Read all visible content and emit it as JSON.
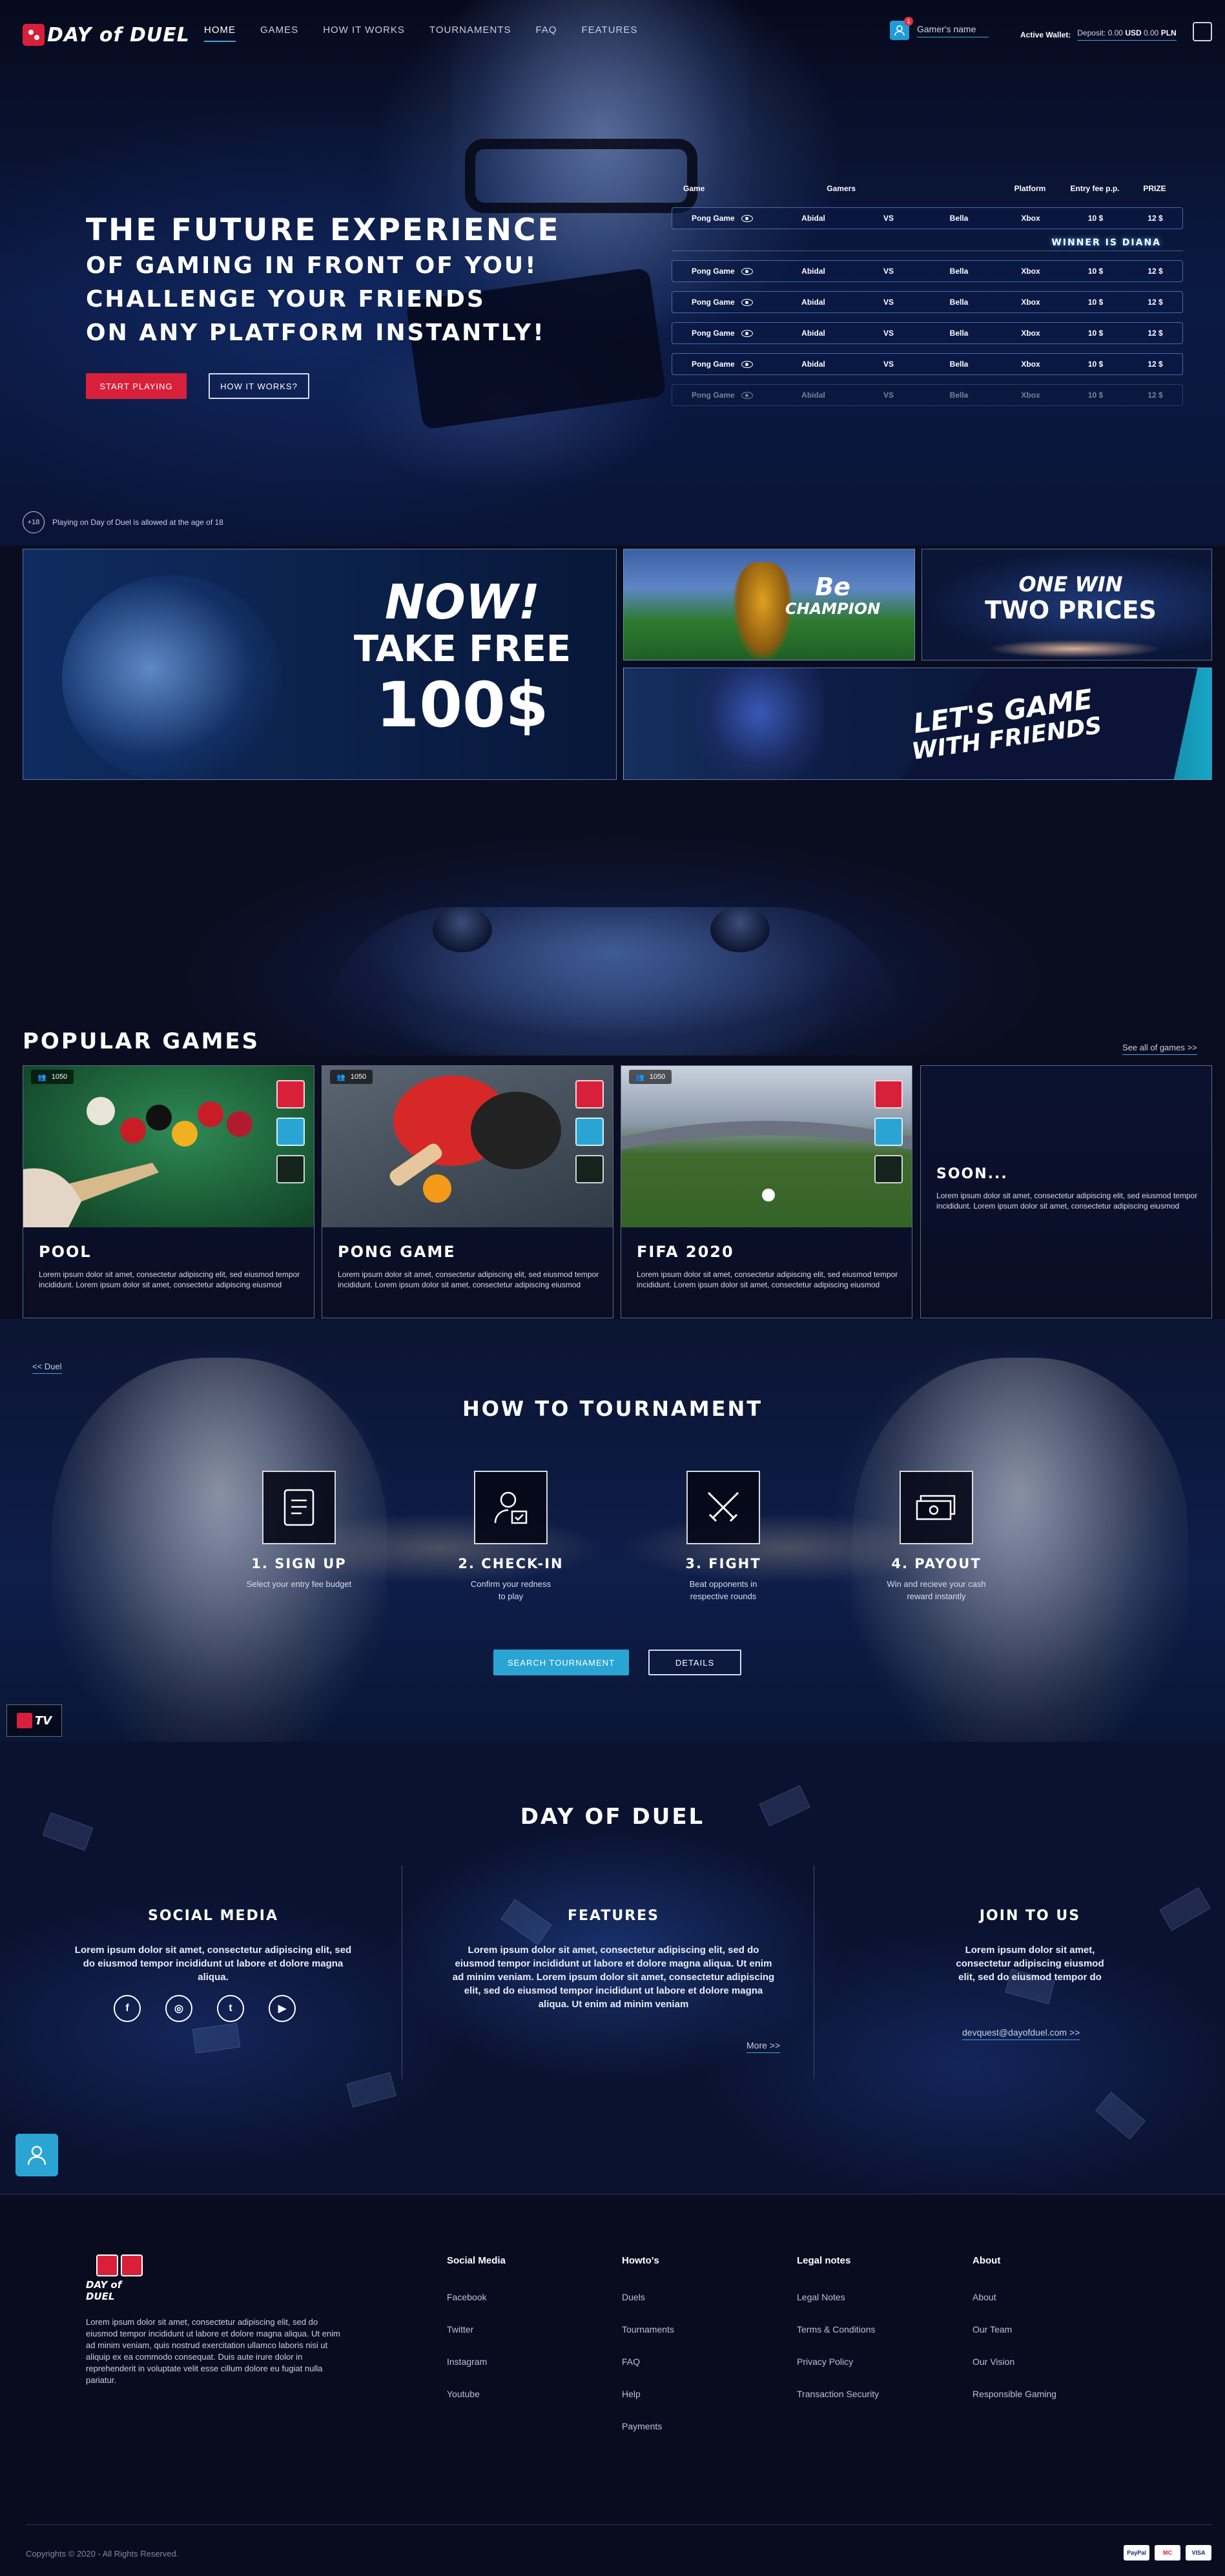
{
  "brand": {
    "logo_text": "DAY of DUEL",
    "accent_red": "#d8203a",
    "accent_blue": "#2aa5d3"
  },
  "nav": {
    "items": [
      "HOME",
      "GAMES",
      "HOW IT WORKS",
      "TOURNAMENTS",
      "FAQ",
      "FEATURES"
    ],
    "active": "HOME"
  },
  "user": {
    "name": "Gamer's name",
    "notifications": "1"
  },
  "wallet": {
    "label": "Active Wallet:",
    "value_prefix": "Deposit: 0.00",
    "usd": "USD",
    "pln_value": "0.00",
    "pln": "PLN"
  },
  "hero": {
    "line1": "THE FUTURE EXPERIENCE",
    "line2": "OF GAMING IN FRONT OF YOU!",
    "line3": "CHALLENGE YOUR FRIENDS",
    "line4": "ON ANY PLATFORM INSTANTLY!",
    "btn_start": "START PLAYING",
    "btn_how": "HOW IT WORKS?"
  },
  "game_table": {
    "headers": [
      "Game",
      "Gamers",
      "",
      "",
      "Platform",
      "Entry fee p.p.",
      "PRIZE"
    ],
    "winner_text": "WINNER IS DIANA",
    "rows": [
      {
        "game": "Pong Game",
        "p1": "Abidal",
        "vs": "VS",
        "p2": "Bella",
        "platform": "Xbox",
        "fee": "10 $",
        "prize": "12 $"
      },
      {
        "game": "Pong Game",
        "p1": "Abidal",
        "vs": "VS",
        "p2": "Bella",
        "platform": "Xbox",
        "fee": "10 $",
        "prize": "12 $"
      },
      {
        "game": "Pong Game",
        "p1": "Abidal",
        "vs": "VS",
        "p2": "Bella",
        "platform": "Xbox",
        "fee": "10 $",
        "prize": "12 $"
      },
      {
        "game": "Pong Game",
        "p1": "Abidal",
        "vs": "VS",
        "p2": "Bella",
        "platform": "Xbox",
        "fee": "10 $",
        "prize": "12 $"
      },
      {
        "game": "Pong Game",
        "p1": "Abidal",
        "vs": "VS",
        "p2": "Bella",
        "platform": "Xbox",
        "fee": "10 $",
        "prize": "12 $"
      },
      {
        "game": "Pong Game",
        "p1": "Abidal",
        "vs": "VS",
        "p2": "Bella",
        "platform": "Xbox",
        "fee": "10 $",
        "prize": "12 $"
      }
    ]
  },
  "age_notice": {
    "badge": "+18",
    "text": "Playing on Day of Duel is allowed at the age of 18"
  },
  "promos": {
    "main": {
      "p1": "NOW!",
      "p2": "TAKE FREE",
      "p3": "100$"
    },
    "champion": {
      "a": "Be",
      "b": "CHAMPION"
    },
    "prices": {
      "a": "ONE WIN",
      "b": "TWO PRICES"
    },
    "friends": {
      "a": "LET'S GAME",
      "b": "WITH FRIENDS"
    }
  },
  "popular": {
    "title": "POPULAR GAMES",
    "see_all": "See all of games >>",
    "cards": [
      {
        "count": "1050",
        "name": "POOL",
        "desc": "Lorem ipsum dolor sit amet, consectetur adipiscing elit, sed eiusmod tempor incididunt. Lorem ipsum dolor sit amet, consectetur adipiscing eiusmod"
      },
      {
        "count": "1050",
        "name": "PONG GAME",
        "desc": "Lorem ipsum dolor sit amet, consectetur adipiscing elit, sed eiusmod tempor incididunt. Lorem ipsum dolor sit amet, consectetur adipiscing eiusmod"
      },
      {
        "count": "1050",
        "name": "FIFA 2020",
        "desc": "Lorem ipsum dolor sit amet, consectetur adipiscing elit, sed eiusmod tempor incididunt. Lorem ipsum dolor sit amet, consectetur adipiscing eiusmod"
      },
      {
        "count": "",
        "name": "SOON...",
        "desc": "Lorem ipsum dolor sit amet, consectetur adipiscing elit, sed eiusmod tempor incididunt. Lorem ipsum dolor sit amet, consectetur adipiscing eiusmod"
      }
    ]
  },
  "tournament": {
    "back": "<< Duel",
    "title": "HOW TO TOURNAMENT",
    "steps": [
      {
        "title": "1. SIGN UP",
        "sub": "Select your entry fee budget"
      },
      {
        "title": "2. CHECK-IN",
        "sub": "Confirm your redness to play"
      },
      {
        "title": "3. FIGHT",
        "sub": "Beat opponents in respective rounds"
      },
      {
        "title": "4. PAYOUT",
        "sub": "Win and recieve your cash reward instantly"
      }
    ],
    "btn_search": "SEARCH TOURNAMENT",
    "btn_details": "DETAILS",
    "tv_label": "TV"
  },
  "info": {
    "title": "DAY OF DUEL",
    "social": {
      "h": "SOCIAL MEDIA",
      "p": "Lorem ipsum dolor sit amet, consectetur adipiscing elit, sed do eiusmod tempor incididunt ut labore et dolore magna aliqua.",
      "icons": [
        "f",
        "◎",
        "t",
        "▶"
      ]
    },
    "features": {
      "h": "FEATURES",
      "p": "Lorem ipsum dolor sit amet, consectetur adipiscing elit, sed do eiusmod tempor incididunt ut labore et dolore magna aliqua. Ut enim ad minim veniam. Lorem ipsum dolor sit amet, consectetur adipiscing elit, sed do eiusmod tempor incididunt ut labore et dolore magna aliqua. Ut enim ad minim veniam",
      "more": "More >>"
    },
    "join": {
      "h": "JOIN TO US",
      "p": "Lorem ipsum dolor sit amet, consectetur adipiscing eiusmod elit, sed do eiusmod tempor do",
      "email": "devquest@dayofduel.com >>"
    }
  },
  "footer": {
    "about": "Lorem ipsum dolor sit amet, consectetur adipiscing elit, sed do eiusmod tempor incididunt ut labore et dolore magna aliqua. Ut enim ad minim veniam, quis nostrud exercitation ullamco laboris nisi ut aliquip ex ea commodo consequat. Duis aute irure dolor in reprehenderit in voluptate velit esse cillum dolore eu fugiat nulla pariatur.",
    "logo_text": "DAY of DUEL",
    "columns": [
      {
        "h": "Social Media",
        "items": [
          "Facebook",
          "Twitter",
          "Instagram",
          "Youtube"
        ]
      },
      {
        "h": "Howto's",
        "items": [
          "Duels",
          "Tournaments",
          "FAQ",
          "Help",
          "Payments"
        ]
      },
      {
        "h": "Legal notes",
        "items": [
          "Legal Notes",
          "Terms & Conditions",
          "Privacy Policy",
          "Transaction Security"
        ]
      },
      {
        "h": "About",
        "items": [
          "About",
          "Our Team",
          "Our Vision",
          "Responsible Gaming"
        ]
      }
    ],
    "copyright": "Copyrights © 2020 - All Rights Reserved.",
    "payments": [
      "PayPal",
      "MC",
      "VISA"
    ]
  }
}
